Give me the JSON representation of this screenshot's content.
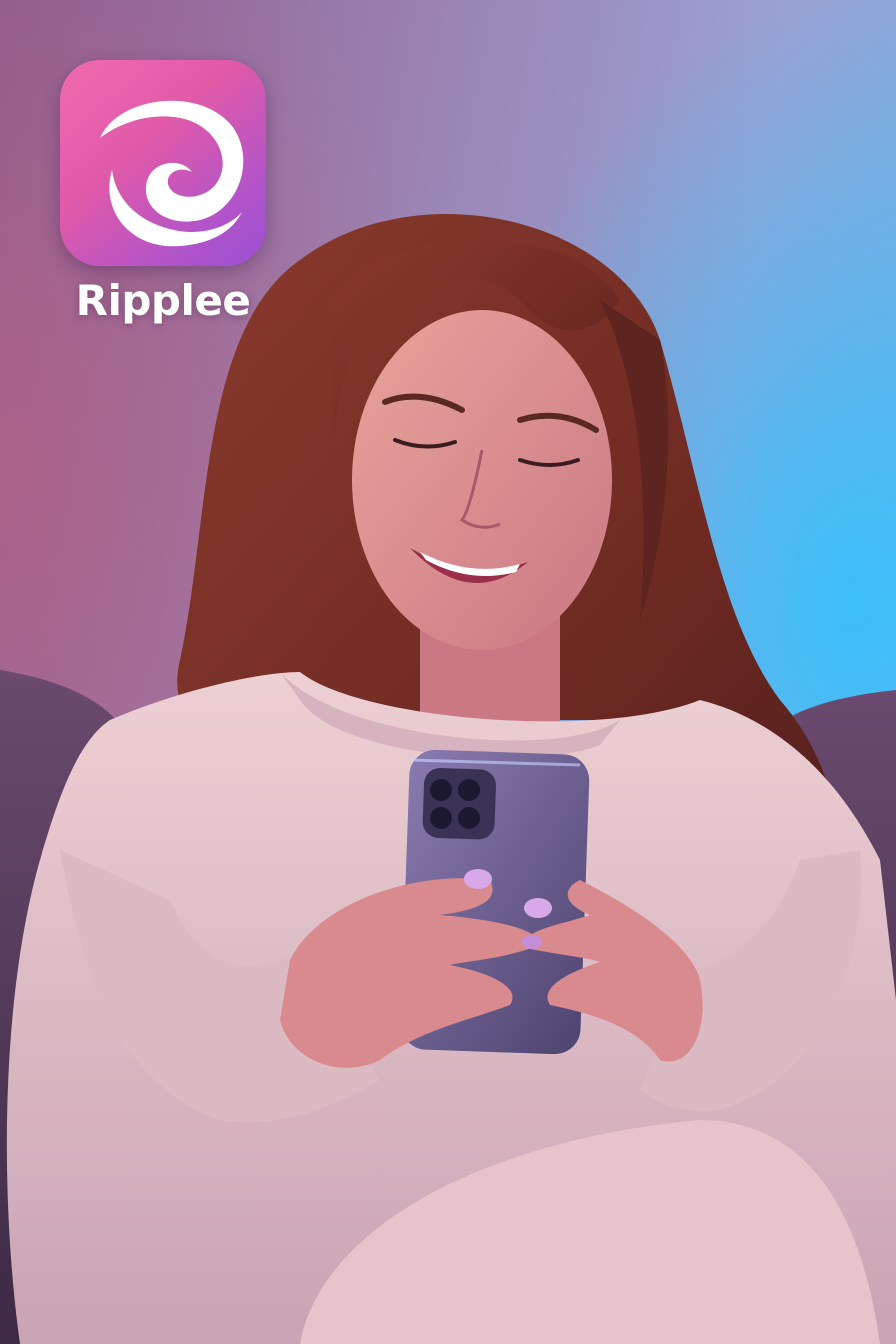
{
  "app": {
    "name": "Ripplee",
    "icon": "swirl-logo-icon",
    "icon_colors": [
      "#f06bb0",
      "#b454c8"
    ]
  },
  "scene": {
    "palette": {
      "wall_left": "#8a5d8f",
      "wall_right": "#6fb3e6",
      "sweater": "#e9c9cf",
      "hair": "#7a3326",
      "phone": "#6b5c8a"
    }
  }
}
